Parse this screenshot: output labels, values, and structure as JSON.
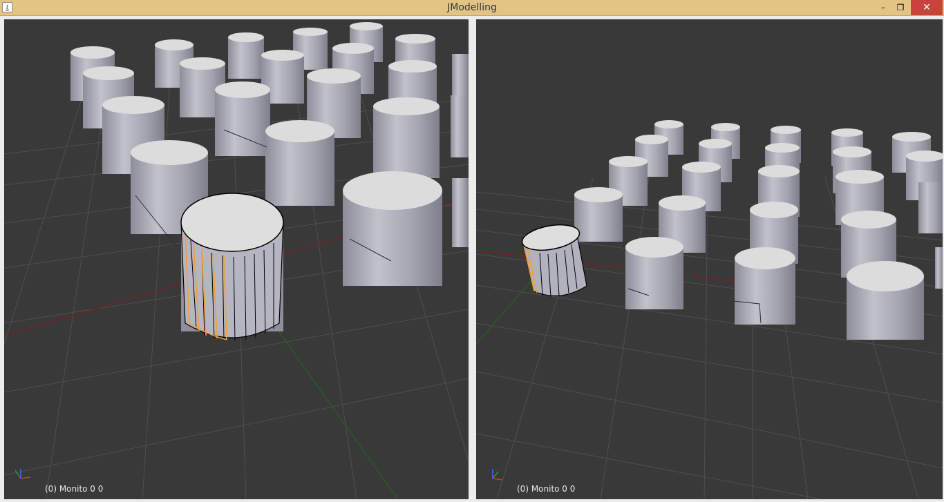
{
  "window": {
    "title": "JModelling",
    "controls": {
      "minimize": "–",
      "maximize": "❐",
      "close": "✕"
    }
  },
  "viewports": [
    {
      "id": "left",
      "status": "(0) Monito 0 0"
    },
    {
      "id": "right",
      "status": "(0) Monito 0 0"
    }
  ],
  "colors": {
    "viewport_bg": "#393939",
    "grid": "#4e4e4e",
    "x_axis": "#8b1a1a",
    "y_axis": "#1d6b1d",
    "selection": "#f0a030",
    "title_bar": "#e3c485"
  }
}
